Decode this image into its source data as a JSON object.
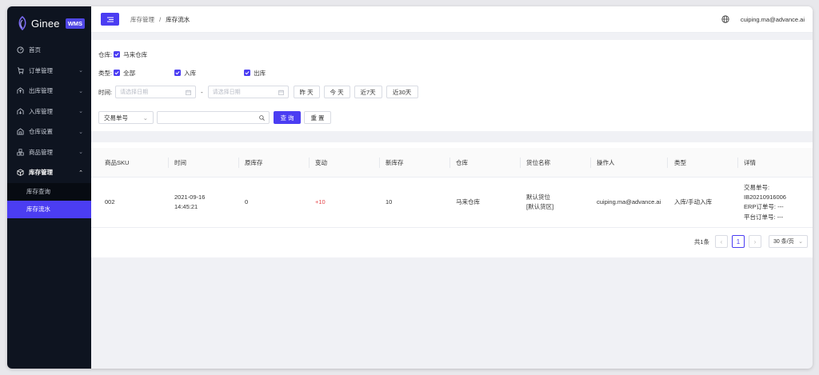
{
  "brand": {
    "name": "Ginee",
    "badge": "WMS"
  },
  "sidebar": {
    "items": [
      {
        "label": "首页",
        "icon": "dashboard-icon",
        "expandable": false
      },
      {
        "label": "订单管理",
        "icon": "cart-icon",
        "expandable": true
      },
      {
        "label": "出库管理",
        "icon": "outbound-icon",
        "expandable": true
      },
      {
        "label": "入库管理",
        "icon": "inbound-icon",
        "expandable": true
      },
      {
        "label": "仓库设置",
        "icon": "warehouse-icon",
        "expandable": true
      },
      {
        "label": "商品管理",
        "icon": "goods-icon",
        "expandable": true
      },
      {
        "label": "库存管理",
        "icon": "cube-icon",
        "expandable": true,
        "open": true
      }
    ],
    "sub_items": [
      {
        "label": "库存查询",
        "active": false
      },
      {
        "label": "库存流水",
        "active": true
      }
    ]
  },
  "header": {
    "breadcrumb": [
      "库存管理",
      "库存流水"
    ],
    "separator": "/",
    "user": "cuiping.ma@advance.ai"
  },
  "filters": {
    "warehouse_label": "仓库:",
    "warehouse_value": "马来仓库",
    "type_label": "类型:",
    "type_options": [
      "全部",
      "入库",
      "出库"
    ],
    "time_label": "时间:",
    "date_placeholder": "请选择日期",
    "date_separator": "-",
    "quick_buttons": [
      "昨 天",
      "今 天",
      "近7天",
      "近30天"
    ],
    "search_field": "交易单号",
    "query_button": "查 询",
    "reset_button": "重 置"
  },
  "table": {
    "columns": [
      "商品SKU",
      "时间",
      "原库存",
      "变动",
      "新库存",
      "仓库",
      "货位名称",
      "操作人",
      "类型",
      "详情"
    ],
    "rows": [
      {
        "sku": "002",
        "time_line1": "2021-09-16",
        "time_line2": "14:45:21",
        "old_stock": "0",
        "change": "+10",
        "new_stock": "10",
        "warehouse": "马来仓库",
        "location_line1": "默认货位",
        "location_line2": "[默认货区]",
        "operator": "cuiping.ma@advance.ai",
        "type": "入库/手动入库",
        "detail_line1": "交易单号:",
        "detail_line2": "IB20210916006",
        "detail_line3": "ERP订单号:  ---",
        "detail_line4": "平台订单号:  ---"
      }
    ]
  },
  "pagination": {
    "total": "共1条",
    "current_page": "1",
    "page_size": "30 条/页"
  },
  "colors": {
    "accent": "#4b3df2",
    "sidebar": "#0e1420",
    "positive_change": "#e5484d"
  }
}
